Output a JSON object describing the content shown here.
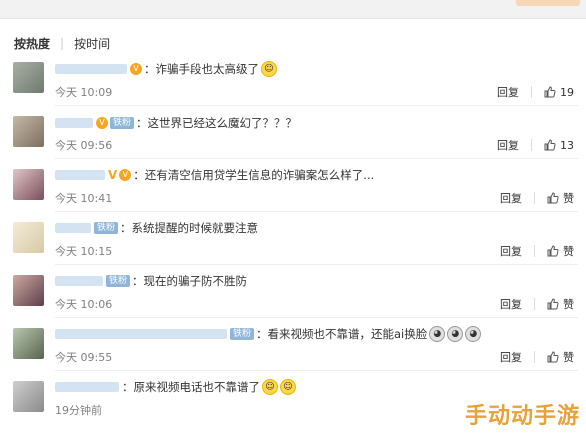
{
  "sort": {
    "hot": "按热度",
    "time": "按时间"
  },
  "reply_label": "回复",
  "comments": [
    {
      "prefix": "：",
      "text": "诈骗手段也太高级了",
      "time": "今天 10:09",
      "likes": "19"
    },
    {
      "badge": "铁粉",
      "prefix": "：",
      "text": "这世界已经这么魔幻了？？？",
      "time": "今天 09:56",
      "likes": "13"
    },
    {
      "prefix": "：",
      "text": "还有清空信用贷学生信息的诈骗案怎么样了...",
      "time": "今天 10:41",
      "likes": "赞"
    },
    {
      "badge": "铁粉",
      "prefix": "：",
      "text": "系统提醒的时候就要注意",
      "time": "今天 10:15",
      "likes": "赞"
    },
    {
      "badge": "铁粉",
      "prefix": "：",
      "text": "现在的骗子防不胜防",
      "time": "今天 10:06",
      "likes": "赞"
    },
    {
      "badge": "铁粉",
      "prefix": "：",
      "text": "看来视频也不靠谱，还能ai换脸",
      "time": "今天 09:55",
      "likes": "赞"
    },
    {
      "prefix": "：",
      "text": "原来视频电话也不靠谱了",
      "time": "19分钟前",
      "likes": "赞"
    }
  ],
  "watermark": "手动动手游",
  "colors": {
    "meta": "#808080",
    "badge": "#8fb5d8",
    "watermark": "#e8a23a"
  }
}
